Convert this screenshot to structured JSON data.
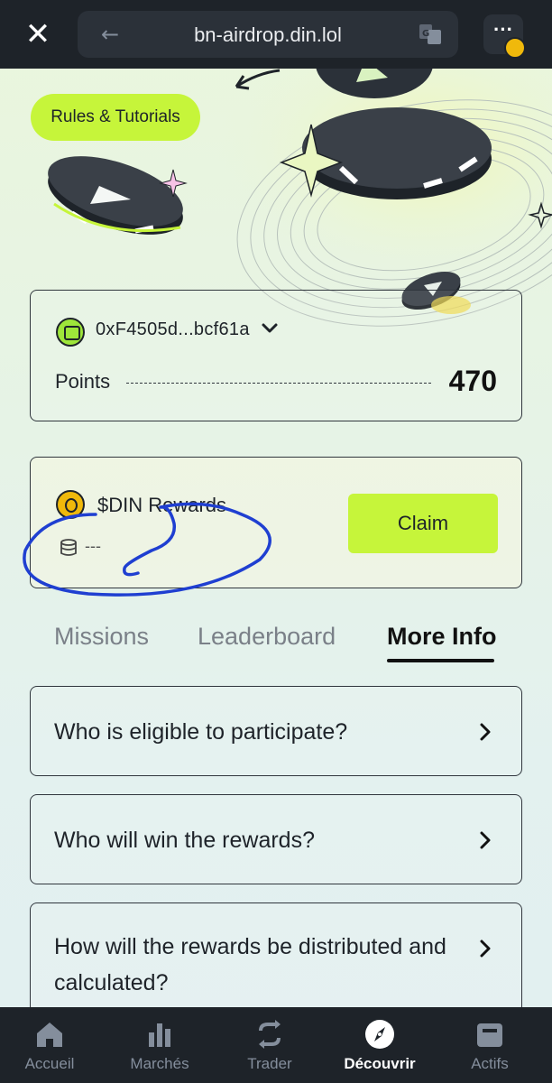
{
  "browser": {
    "close_label": "✕",
    "back_label": "←",
    "url": "bn-airdrop.din.lol",
    "menu_label": "···"
  },
  "hero": {
    "rules_button": "Rules & Tutorials"
  },
  "wallet": {
    "address": "0xF4505d...bcf61a",
    "points_label": "Points",
    "points_value": "470"
  },
  "rewards": {
    "title": "$DIN Rewards",
    "amount": "---",
    "claim_label": "Claim"
  },
  "tabs": [
    {
      "label": "Missions",
      "active": false
    },
    {
      "label": "Leaderboard",
      "active": false
    },
    {
      "label": "More Info",
      "active": true
    }
  ],
  "faq": [
    {
      "question": "Who is eligible to participate?"
    },
    {
      "question": "Who will win the rewards?"
    },
    {
      "question": "How will the rewards be distributed and calculated?"
    }
  ],
  "bottom_nav": [
    {
      "label": "Accueil",
      "icon": "home-icon",
      "active": false
    },
    {
      "label": "Marchés",
      "icon": "bar-chart-icon",
      "active": false
    },
    {
      "label": "Trader",
      "icon": "swap-icon",
      "active": false
    },
    {
      "label": "Découvrir",
      "icon": "compass-icon",
      "active": true
    },
    {
      "label": "Actifs",
      "icon": "wallet-icon",
      "active": false
    }
  ],
  "colors": {
    "accent": "#c6f53a",
    "nav_bg": "#1e2329",
    "coin": "#f0b90b",
    "annotation_ink": "#1f3fd1"
  }
}
